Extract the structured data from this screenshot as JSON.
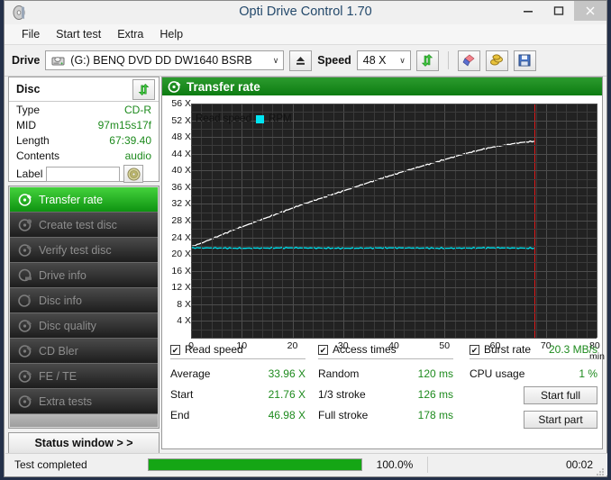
{
  "window": {
    "title": "Opti Drive Control 1.70",
    "app_icon": "disc-icon",
    "minimize_label": "–",
    "maximize_label": "❐",
    "close_label": "×"
  },
  "menu": {
    "items": [
      {
        "label": "File"
      },
      {
        "label": "Start test"
      },
      {
        "label": "Extra"
      },
      {
        "label": "Help"
      }
    ]
  },
  "toolbar": {
    "drive_label": "Drive",
    "drive_value": "(G:)   BENQ DVD DD DW1640 BSRB",
    "drive_icon": "drive-icon",
    "eject_icon": "eject-icon",
    "speed_label": "Speed",
    "speed_value": "48 X",
    "refresh_icon": "refresh-icon",
    "erase_icon": "eraser-icon",
    "coins_icon": "coins-icon",
    "save_icon": "floppy-save-icon",
    "dropdown_arrow": "∨"
  },
  "disc_panel": {
    "header": "Disc",
    "refresh_icon": "refresh-icon",
    "rows": [
      {
        "key": "Type",
        "value": "CD-R"
      },
      {
        "key": "MID",
        "value": "97m15s17f"
      },
      {
        "key": "Length",
        "value": "67:39.40"
      },
      {
        "key": "Contents",
        "value": "audio"
      }
    ],
    "label_key": "Label",
    "label_value": "",
    "label_placeholder": "",
    "label_button_icon": "disc-icon"
  },
  "sidebar": {
    "items": [
      {
        "label": "Transfer rate",
        "icon": "disc-test-icon",
        "active": true
      },
      {
        "label": "Create test disc",
        "icon": "disc-create-icon",
        "active": false
      },
      {
        "label": "Verify test disc",
        "icon": "disc-verify-icon",
        "active": false
      },
      {
        "label": "Drive info",
        "icon": "drive-info-icon",
        "active": false
      },
      {
        "label": "Disc info",
        "icon": "disc-info-icon",
        "active": false
      },
      {
        "label": "Disc quality",
        "icon": "disc-quality-icon",
        "active": false
      },
      {
        "label": "CD Bler",
        "icon": "disc-bler-icon",
        "active": false
      },
      {
        "label": "FE / TE",
        "icon": "disc-fete-icon",
        "active": false
      },
      {
        "label": "Extra tests",
        "icon": "disc-extra-icon",
        "active": false
      }
    ],
    "status_window_label": "Status window > >"
  },
  "panel": {
    "title": "Transfer rate",
    "title_icon": "disc-test-icon"
  },
  "chart_data": {
    "type": "line",
    "title": "Transfer rate",
    "xlabel": "min",
    "ylabel": "X",
    "xlim": [
      0,
      80
    ],
    "ylim": [
      0,
      56
    ],
    "grid": true,
    "legend_position": "top-left",
    "x_ticks": [
      0,
      10,
      20,
      30,
      40,
      50,
      60,
      70,
      80
    ],
    "x_tick_labels": [
      "0",
      "10",
      "20",
      "30",
      "40",
      "50",
      "60",
      "70",
      "80 min"
    ],
    "y_ticks": [
      4,
      8,
      12,
      16,
      20,
      24,
      28,
      32,
      36,
      40,
      44,
      48,
      52,
      56
    ],
    "y_tick_labels": [
      "4 X",
      "8 X",
      "12 X",
      "16 X",
      "20 X",
      "24 X",
      "28 X",
      "32 X",
      "36 X",
      "40 X",
      "44 X",
      "48 X",
      "52 X",
      "56 X"
    ],
    "marker_line": {
      "x": 67.7,
      "color": "#e01b1b",
      "name": "end-of-disc-marker"
    },
    "series": [
      {
        "name": "Read speed",
        "color": "#ffffff",
        "x": [
          0,
          2,
          4,
          6,
          8,
          10,
          12,
          14,
          16,
          18,
          20,
          22,
          24,
          26,
          28,
          30,
          32,
          34,
          36,
          38,
          40,
          42,
          44,
          46,
          48,
          50,
          52,
          54,
          56,
          58,
          60,
          62,
          64,
          66,
          67.7
        ],
        "values": [
          21.76,
          22.6,
          23.6,
          24.6,
          25.6,
          26.5,
          27.4,
          28.3,
          29.2,
          30.1,
          31.0,
          31.9,
          32.7,
          33.5,
          34.3,
          35.1,
          35.9,
          36.7,
          37.5,
          38.3,
          39.0,
          39.8,
          40.5,
          41.2,
          41.9,
          42.6,
          43.3,
          44.0,
          44.6,
          45.2,
          45.7,
          46.1,
          46.5,
          46.8,
          46.98
        ]
      },
      {
        "name": "RPM",
        "color": "#00e5f2",
        "x": [
          0,
          10,
          20,
          30,
          40,
          50,
          60,
          67.7
        ],
        "values": [
          21.5,
          21.4,
          21.5,
          21.4,
          21.5,
          21.4,
          21.5,
          21.4
        ]
      }
    ]
  },
  "stats": {
    "read_speed": {
      "header": "Read speed",
      "checked": true,
      "check_glyph": "✔",
      "rows": [
        {
          "key": "Average",
          "value": "33.96 X"
        },
        {
          "key": "Start",
          "value": "21.76 X"
        },
        {
          "key": "End",
          "value": "46.98 X"
        }
      ]
    },
    "access_times": {
      "header": "Access times",
      "checked": true,
      "check_glyph": "✔",
      "rows": [
        {
          "key": "Random",
          "value": "120 ms"
        },
        {
          "key": "1/3 stroke",
          "value": "126 ms"
        },
        {
          "key": "Full stroke",
          "value": "178 ms"
        }
      ]
    },
    "burst": {
      "header": "Burst rate",
      "checked": true,
      "check_glyph": "✔",
      "header_value": "20.3 MB/s",
      "cpu_key": "CPU usage",
      "cpu_value": "1 %",
      "start_full_label": "Start full",
      "start_part_label": "Start part"
    }
  },
  "statusbar": {
    "text": "Test completed",
    "progress_percent": 100.0,
    "progress_label": "100.0%",
    "elapsed": "00:02",
    "progress_color": "#15a615",
    "resize_grip_icon": "resize-grip-icon"
  }
}
